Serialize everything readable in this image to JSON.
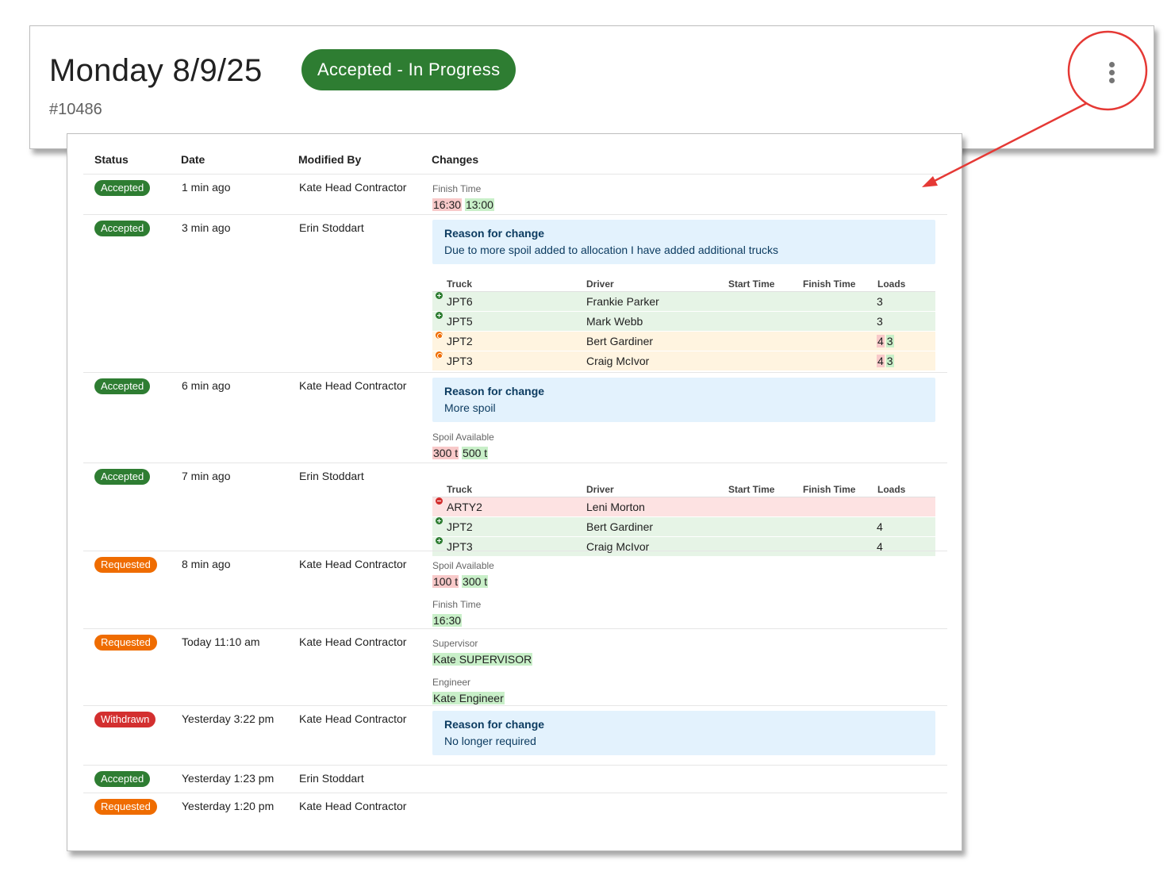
{
  "header": {
    "title": "Monday 8/9/25",
    "status": "Accepted - In Progress",
    "order_number": "#10486",
    "status_color": "#2e7d32"
  },
  "menu": {
    "icon": "more-vertical-icon"
  },
  "history": {
    "columns": {
      "status": "Status",
      "date": "Date",
      "modified_by": "Modified By",
      "changes": "Changes"
    },
    "truck_columns": {
      "truck": "Truck",
      "driver": "Driver",
      "start": "Start Time",
      "finish": "Finish Time",
      "loads": "Loads"
    },
    "reason_title": "Reason for change",
    "rows": [
      {
        "status": "Accepted",
        "date": "1 min ago",
        "user": "Kate Head Contractor",
        "fields": [
          {
            "label": "Finish Time",
            "old": "16:30",
            "new": "13:00"
          }
        ]
      },
      {
        "status": "Accepted",
        "date": "3 min ago",
        "user": "Erin Stoddart",
        "reason": "Due to more spoil added to allocation I have added additional trucks",
        "trucks": [
          {
            "change": "added",
            "truck": "JPT6",
            "driver": "Frankie Parker",
            "loads": "3"
          },
          {
            "change": "added",
            "truck": "JPT5",
            "driver": "Mark Webb",
            "loads": "3"
          },
          {
            "change": "changed",
            "truck": "JPT2",
            "driver": "Bert Gardiner",
            "loads_old": "4",
            "loads_new": "3"
          },
          {
            "change": "changed",
            "truck": "JPT3",
            "driver": "Craig McIvor",
            "loads_old": "4",
            "loads_new": "3"
          }
        ]
      },
      {
        "status": "Accepted",
        "date": "6 min ago",
        "user": "Kate Head Contractor",
        "reason": "More spoil",
        "fields": [
          {
            "label": "Spoil Available",
            "old": "300 t",
            "new": "500 t"
          }
        ]
      },
      {
        "status": "Accepted",
        "date": "7 min ago",
        "user": "Erin Stoddart",
        "trucks": [
          {
            "change": "removed",
            "truck": "ARTY2",
            "driver": "Leni Morton",
            "loads": ""
          },
          {
            "change": "added",
            "truck": "JPT2",
            "driver": "Bert Gardiner",
            "loads": "4"
          },
          {
            "change": "added",
            "truck": "JPT3",
            "driver": "Craig McIvor",
            "loads": "4"
          }
        ]
      },
      {
        "status": "Requested",
        "date": "8 min ago",
        "user": "Kate Head Contractor",
        "fields": [
          {
            "label": "Spoil Available",
            "old": "100 t",
            "new": "300 t"
          },
          {
            "label": "Finish Time",
            "new": "16:30"
          }
        ]
      },
      {
        "status": "Requested",
        "date": "Today 11:10 am",
        "user": "Kate Head Contractor",
        "fields": [
          {
            "label": "Supervisor",
            "new": "Kate SUPERVISOR"
          },
          {
            "label": "Engineer",
            "new": "Kate Engineer"
          }
        ]
      },
      {
        "status": "Withdrawn",
        "date": "Yesterday 3:22 pm",
        "user": "Kate Head Contractor",
        "reason": "No longer required"
      },
      {
        "status": "Accepted",
        "date": "Yesterday 1:23 pm",
        "user": "Erin Stoddart"
      },
      {
        "status": "Requested",
        "date": "Yesterday 1:20 pm",
        "user": "Kate Head Contractor"
      }
    ]
  },
  "colors": {
    "accepted": "#2e7d32",
    "requested": "#ef6c00",
    "withdrawn": "#d32f2f",
    "old_value": "#f8c9c9",
    "new_value": "#c8efc8",
    "reason_bg": "#e3f2fd",
    "annotation": "#e53935"
  }
}
